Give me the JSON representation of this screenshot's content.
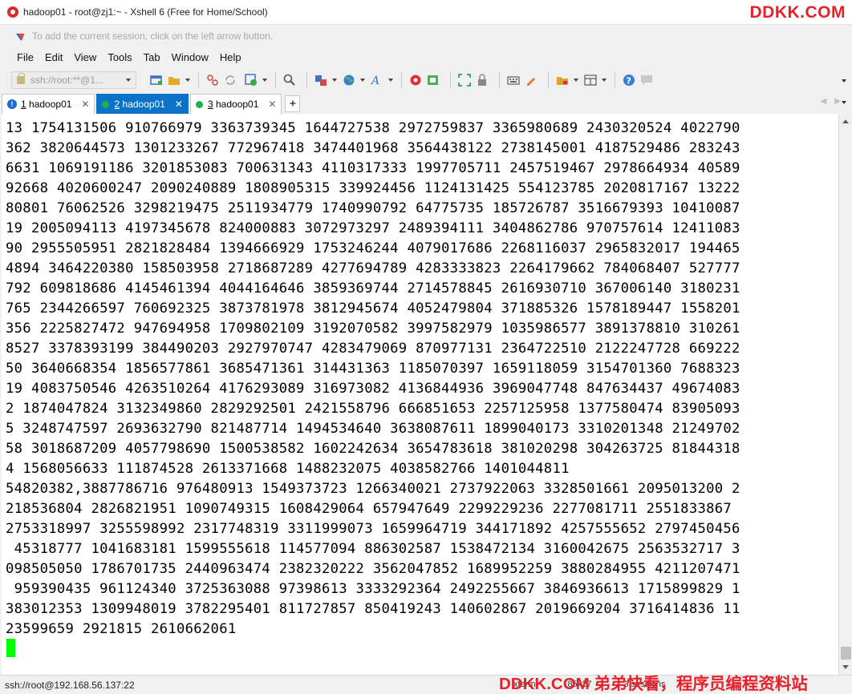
{
  "window": {
    "title": "hadoop01 - root@zj1:~ - Xshell 6 (Free for Home/School)"
  },
  "watermark": {
    "top": "DDKK.COM",
    "bottom": "DDKK.COM 弟弟快看，程序员编程资料站"
  },
  "hint": {
    "text": "To add the current session, click on the left arrow button."
  },
  "menu": {
    "items": [
      "File",
      "Edit",
      "View",
      "Tools",
      "Tab",
      "Window",
      "Help"
    ]
  },
  "toolbar": {
    "address_value": "ssh://root:**@1..."
  },
  "tabs": [
    {
      "number": "1",
      "label": "hadoop01",
      "status": "info",
      "active": false
    },
    {
      "number": "2",
      "label": "hadoop01",
      "status": "connected",
      "active": true
    },
    {
      "number": "3",
      "label": "hadoop01",
      "status": "connected",
      "active": false
    }
  ],
  "colors": {
    "active_tab": "#0a73c7",
    "connected_dot": "#21b04b",
    "cursor": "#00ff00",
    "watermark": "#e8202a"
  },
  "terminal": {
    "lines": [
      "13 1754131506 910766979 3363739345 1644727538 2972759837 3365980689 2430320524 4022790",
      "362 3820644573 1301233267 772967418 3474401968 3564438122 2738145001 4187529486 283243",
      "6631 1069191186 3201853083 700631343 4110317333 1997705711 2457519467 2978664934 40589",
      "92668 4020600247 2090240889 1808905315 339924456 1124131425 554123785 2020817167 13222",
      "80801 76062526 3298219475 2511934779 1740990792 64775735 185726787 3516679393 10410087",
      "19 2005094113 4197345678 824000883 3072973297 2489394111 3404862786 970757614 12411083",
      "90 2955505951 2821828484 1394666929 1753246244 4079017686 2268116037 2965832017 194465",
      "4894 3464220380 158503958 2718687289 4277694789 4283333823 2264179662 784068407 527777",
      "792 609818686 4145461394 4044164646 3859369744 2714578845 2616930710 367006140 3180231",
      "765 2344266597 760692325 3873781978 3812945674 4052479804 371885326 1578189447 1558201",
      "356 2225827472 947694958 1709802109 3192070582 3997582979 1035986577 3891378810 310261",
      "8527 3378393199 384490203 2927970747 4283479069 870977131 2364722510 2122247728 669222",
      "50 3640668354 1856577861 3685471361 314431363 1185070397 1659118059 3154701360 7688323",
      "19 4083750546 4263510264 4176293089 316973082 4136844936 3969047748 847634437 49674083",
      "2 1874047824 3132349860 2829292501 2421558796 666851653 2257125958 1377580474 83905093",
      "5 3248747597 2693632790 821487714 1494534640 3638087611 1899040173 3310201348 21249702",
      "58 3018687209 4057798690 1500538582 1602242634 3654783618 381020298 304263725 81844318",
      "4 1568056633 111874528 2613371668 1488232075 4038582766 1401044811",
      "54820382,3887786716 976480913 1549373723 1266340021 2737922063 3328501661 2095013200 2",
      "218536804 2826821951 1090749315 1608429064 657947649 2299229236 2277081711 2551833867",
      "2753318997 3255598992 2317748319 3311999073 1659964719 344171892 4257555652 2797450456",
      " 45318777 1041683181 1599555618 114577094 886302587 1538472134 3160042675 2563532717 3",
      "098505050 1786701735 2440963474 2382320222 3562047852 1689952259 3880284955 4211207471",
      " 959390435 961124340 3725363088 97398613 3333292364 2492255667 3846936613 1715899829 1",
      "383012353 1309948019 3782295401 811727857 850419243 140602867 2019669204 3716414836 11",
      "23599659 2921815 2610662061"
    ]
  },
  "status": {
    "connection": "ssh://root@192.168.56.137:22",
    "term_type": "xterm",
    "size": "85x27",
    "sessions": "3 sessions"
  }
}
